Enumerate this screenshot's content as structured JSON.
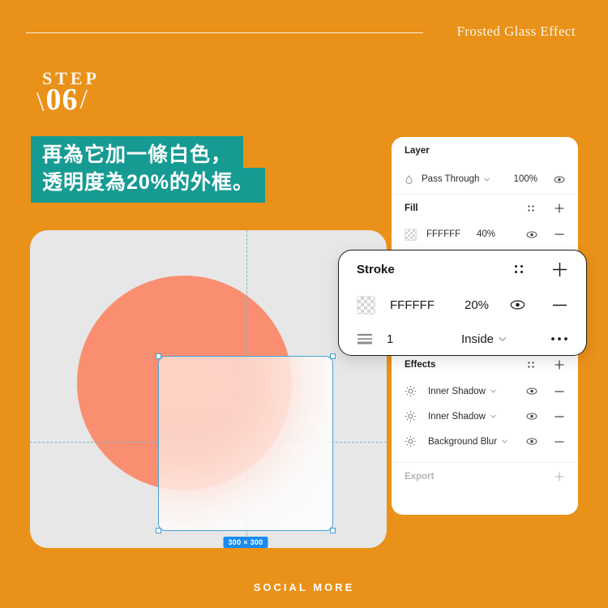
{
  "header": {
    "title": "Frosted Glass Effect"
  },
  "step": {
    "word": "STEP",
    "number": "06",
    "slash_left": "\\",
    "slash_right": "/"
  },
  "callout": {
    "line1": "再為它加一條白色，",
    "line2": "透明度為20%的外框。",
    "bg_color": "#169b93"
  },
  "canvas": {
    "dimension_badge": "300 × 300",
    "circle_color": "#f98f70",
    "background_color": "#e7e7e7",
    "selection_color": "#46a3d3"
  },
  "panel": {
    "layer": {
      "title": "Layer",
      "blend_mode": "Pass Through",
      "opacity": "100%"
    },
    "fill": {
      "title": "Fill",
      "hex": "FFFFFF",
      "opacity": "40%"
    },
    "effects": {
      "title": "Effects",
      "items": [
        {
          "name": "Inner Shadow"
        },
        {
          "name": "Inner Shadow"
        },
        {
          "name": "Background Blur"
        }
      ]
    },
    "export": {
      "title": "Export"
    }
  },
  "stroke_card": {
    "title": "Stroke",
    "hex": "FFFFFF",
    "opacity": "20%",
    "weight": "1",
    "align": "Inside"
  },
  "footer": {
    "brand": "SOCIAL MORE"
  },
  "theme": {
    "background": "#ea9119"
  }
}
